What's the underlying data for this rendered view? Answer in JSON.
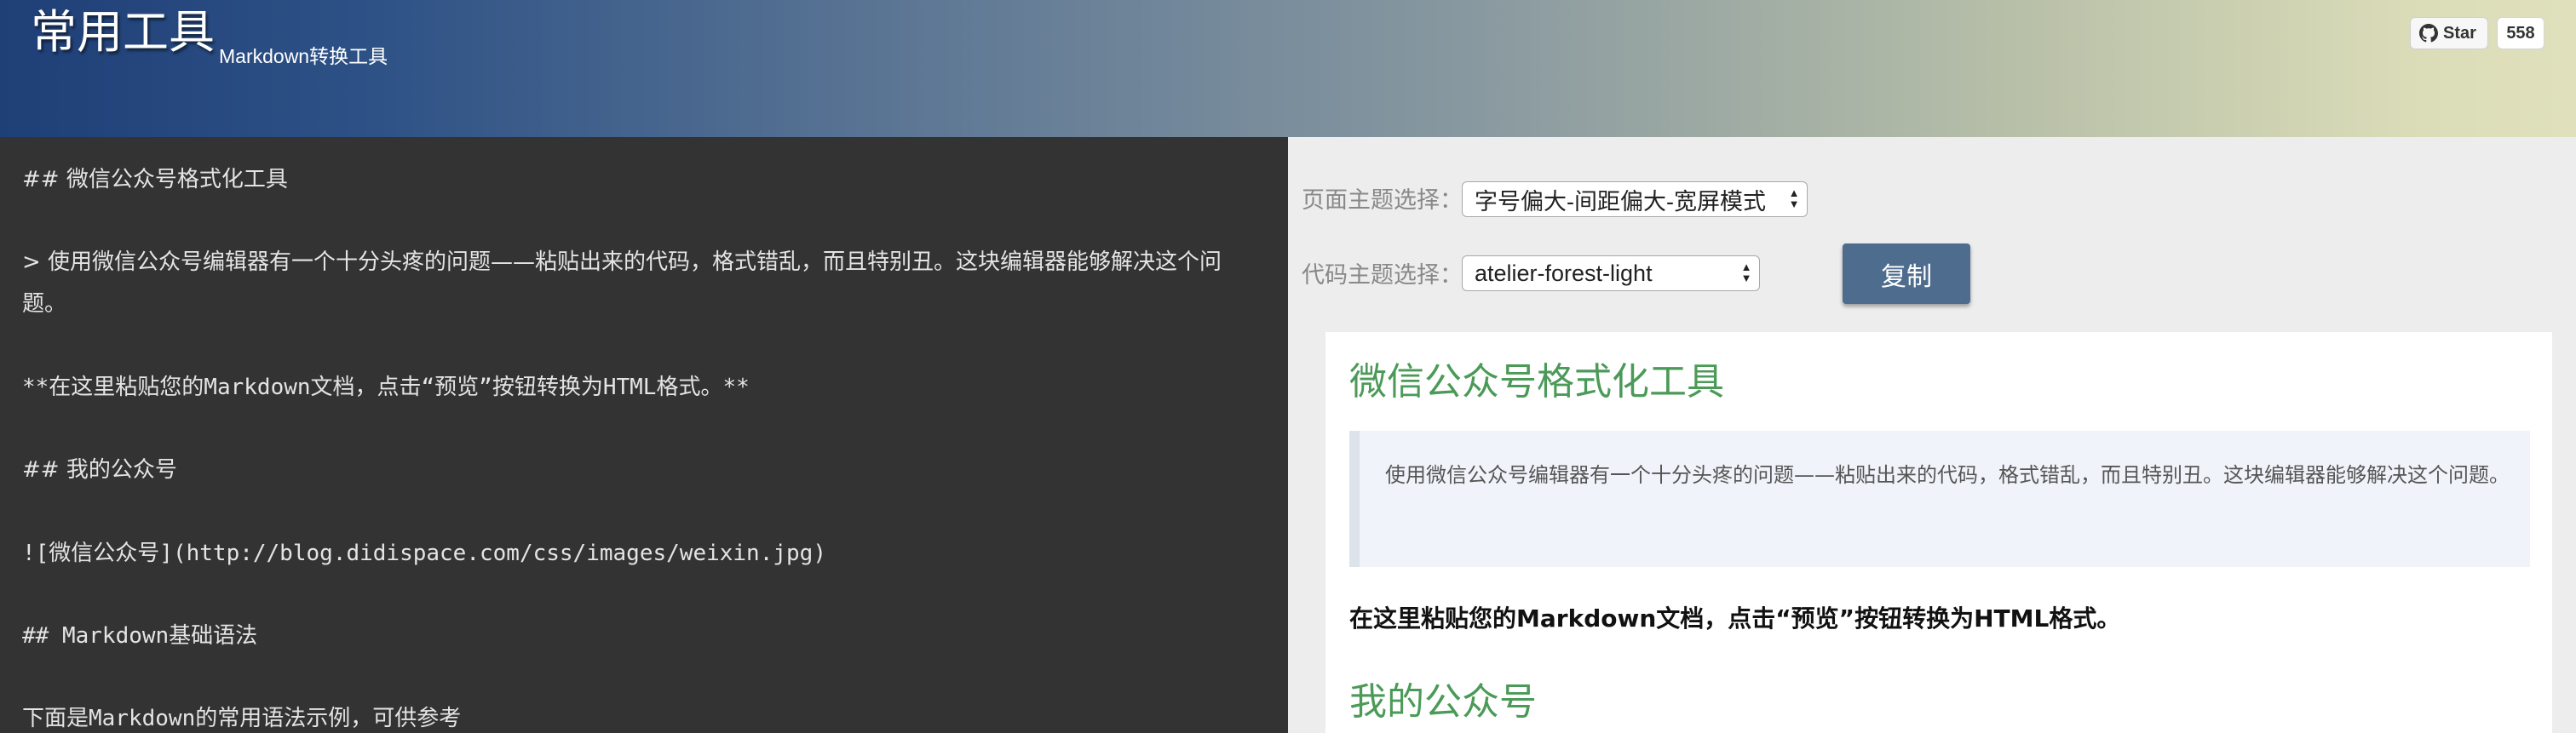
{
  "header": {
    "title": "常用工具",
    "subtitle": "Markdown转换工具",
    "star_label": "Star",
    "star_count": "558",
    "icon": "github-icon"
  },
  "editor": {
    "lines": [
      "## 微信公众号格式化工具",
      "> 使用微信公众号编辑器有一个十分头疼的问题——粘贴出来的代码，格式错乱，而且特别丑。这块编辑器能够解决这个问",
      "题。",
      "**在这里粘贴您的Markdown文档，点击“预览”按钮转换为HTML格式。**",
      "## 我的公众号",
      "![微信公众号](http://blog.didispace.com/css/images/weixin.jpg)",
      "## Markdown基础语法",
      "下面是Markdown的常用语法示例，可供参考"
    ]
  },
  "controls": {
    "page_theme_label": "页面主题选择：",
    "page_theme_value": "字号偏大-间距偏大-宽屏模式",
    "code_theme_label": "代码主题选择：",
    "code_theme_value": "atelier-forest-light",
    "copy_label": "复制"
  },
  "preview": {
    "heading1": "微信公众号格式化工具",
    "quote": "使用微信公众号编辑器有一个十分头疼的问题——粘贴出来的代码，格式错乱，而且特别丑。这块编辑器能够解决这个问题。",
    "bold_text": "在这里粘贴您的Markdown文档，点击“预览”按钮转换为HTML格式。",
    "heading2": "我的公众号"
  },
  "colors": {
    "editor_bg": "#333333",
    "heading_green": "#4b9a58",
    "button_blue": "#4e6d8e"
  }
}
